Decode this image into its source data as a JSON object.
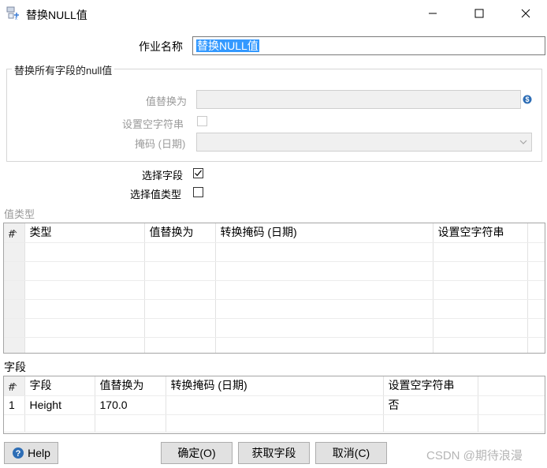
{
  "window": {
    "title": "替换NULL值"
  },
  "form": {
    "job_name_label": "作业名称",
    "job_name_value": "替换NULL值",
    "group_title": "替换所有字段的null值",
    "replace_with_label": "值替换为",
    "set_empty_label": "设置空字符串",
    "mask_label": "掩码 (日期)",
    "select_fields_label": "选择字段",
    "select_fields_checked": true,
    "select_value_type_label": "选择值类型",
    "select_value_type_checked": false
  },
  "value_type_section": {
    "label": "值类型",
    "columns": [
      "#",
      "类型",
      "值替换为",
      "转换掩码 (日期)",
      "设置空字符串"
    ]
  },
  "fields_section": {
    "label": "字段",
    "columns": [
      "#",
      "字段",
      "值替换为",
      "转换掩码 (日期)",
      "设置空字符串"
    ],
    "rows": [
      {
        "num": "1",
        "field": "Height",
        "replace": "170.0",
        "mask": "",
        "set_empty": "否"
      }
    ]
  },
  "buttons": {
    "help": "Help",
    "ok": "确定(O)",
    "get_fields": "获取字段",
    "cancel": "取消(C)"
  },
  "watermark": "CSDN @期待浪漫"
}
